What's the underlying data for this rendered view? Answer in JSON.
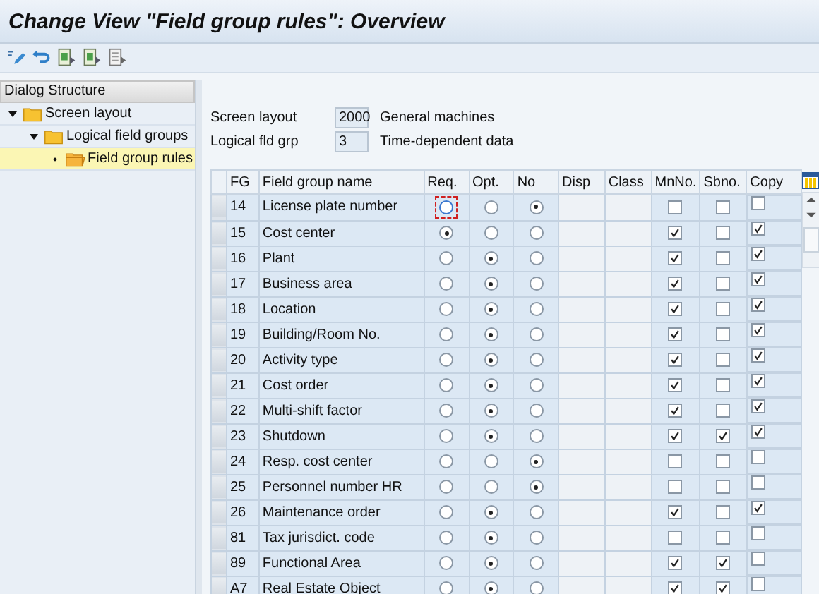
{
  "window": {
    "title": "Change View \"Field group rules\": Overview"
  },
  "toolbar": {
    "buttons": [
      {
        "kind": "edit"
      },
      {
        "kind": "undo"
      },
      {
        "kind": "doc-green"
      },
      {
        "kind": "doc-green"
      },
      {
        "kind": "doc-grey"
      }
    ]
  },
  "dialog_structure": {
    "title": "Dialog Structure",
    "items": [
      {
        "label": "Screen layout",
        "expanded": true,
        "selected": false,
        "children": [
          {
            "label": "Logical field groups",
            "expanded": true,
            "selected": false,
            "children": [
              {
                "label": "Field group rules",
                "expanded": false,
                "selected": true
              }
            ]
          }
        ]
      }
    ]
  },
  "header_fields": [
    {
      "label": "Screen layout",
      "value": "2000",
      "description": "General machines"
    },
    {
      "label": "Logical fld grp",
      "value": "3",
      "description": "Time-dependent data"
    }
  ],
  "table": {
    "columns": [
      "FG",
      "Field group name",
      "Req.",
      "Opt.",
      "No",
      "Disp",
      "Class",
      "MnNo.",
      "Sbno.",
      "Copy"
    ],
    "rows": [
      {
        "fg": "14",
        "name": "License plate number",
        "req": false,
        "opt": false,
        "no": true,
        "focused": true,
        "mnno": false,
        "sbno": false,
        "copy": false
      },
      {
        "fg": "15",
        "name": "Cost center",
        "req": true,
        "opt": false,
        "no": false,
        "focused": false,
        "mnno": true,
        "sbno": false,
        "copy": true
      },
      {
        "fg": "16",
        "name": "Plant",
        "req": false,
        "opt": true,
        "no": false,
        "focused": false,
        "mnno": true,
        "sbno": false,
        "copy": true
      },
      {
        "fg": "17",
        "name": "Business area",
        "req": false,
        "opt": true,
        "no": false,
        "focused": false,
        "mnno": true,
        "sbno": false,
        "copy": true
      },
      {
        "fg": "18",
        "name": "Location",
        "req": false,
        "opt": true,
        "no": false,
        "focused": false,
        "mnno": true,
        "sbno": false,
        "copy": true
      },
      {
        "fg": "19",
        "name": "Building/Room No.",
        "req": false,
        "opt": true,
        "no": false,
        "focused": false,
        "mnno": true,
        "sbno": false,
        "copy": true
      },
      {
        "fg": "20",
        "name": "Activity type",
        "req": false,
        "opt": true,
        "no": false,
        "focused": false,
        "mnno": true,
        "sbno": false,
        "copy": true
      },
      {
        "fg": "21",
        "name": "Cost order",
        "req": false,
        "opt": true,
        "no": false,
        "focused": false,
        "mnno": true,
        "sbno": false,
        "copy": true
      },
      {
        "fg": "22",
        "name": "Multi-shift factor",
        "req": false,
        "opt": true,
        "no": false,
        "focused": false,
        "mnno": true,
        "sbno": false,
        "copy": true
      },
      {
        "fg": "23",
        "name": "Shutdown",
        "req": false,
        "opt": true,
        "no": false,
        "focused": false,
        "mnno": true,
        "sbno": true,
        "copy": true
      },
      {
        "fg": "24",
        "name": "Resp. cost center",
        "req": false,
        "opt": false,
        "no": true,
        "focused": false,
        "mnno": false,
        "sbno": false,
        "copy": false
      },
      {
        "fg": "25",
        "name": "Personnel number HR",
        "req": false,
        "opt": false,
        "no": true,
        "focused": false,
        "mnno": false,
        "sbno": false,
        "copy": false
      },
      {
        "fg": "26",
        "name": "Maintenance order",
        "req": false,
        "opt": true,
        "no": false,
        "focused": false,
        "mnno": true,
        "sbno": false,
        "copy": true
      },
      {
        "fg": "81",
        "name": "Tax jurisdict. code",
        "req": false,
        "opt": true,
        "no": false,
        "focused": false,
        "mnno": false,
        "sbno": false,
        "copy": false
      },
      {
        "fg": "89",
        "name": "Functional Area",
        "req": false,
        "opt": true,
        "no": false,
        "focused": false,
        "mnno": true,
        "sbno": true,
        "copy": false
      },
      {
        "fg": "A7",
        "name": "Real Estate Object",
        "req": false,
        "opt": true,
        "no": false,
        "focused": false,
        "mnno": true,
        "sbno": true,
        "copy": false
      }
    ]
  }
}
